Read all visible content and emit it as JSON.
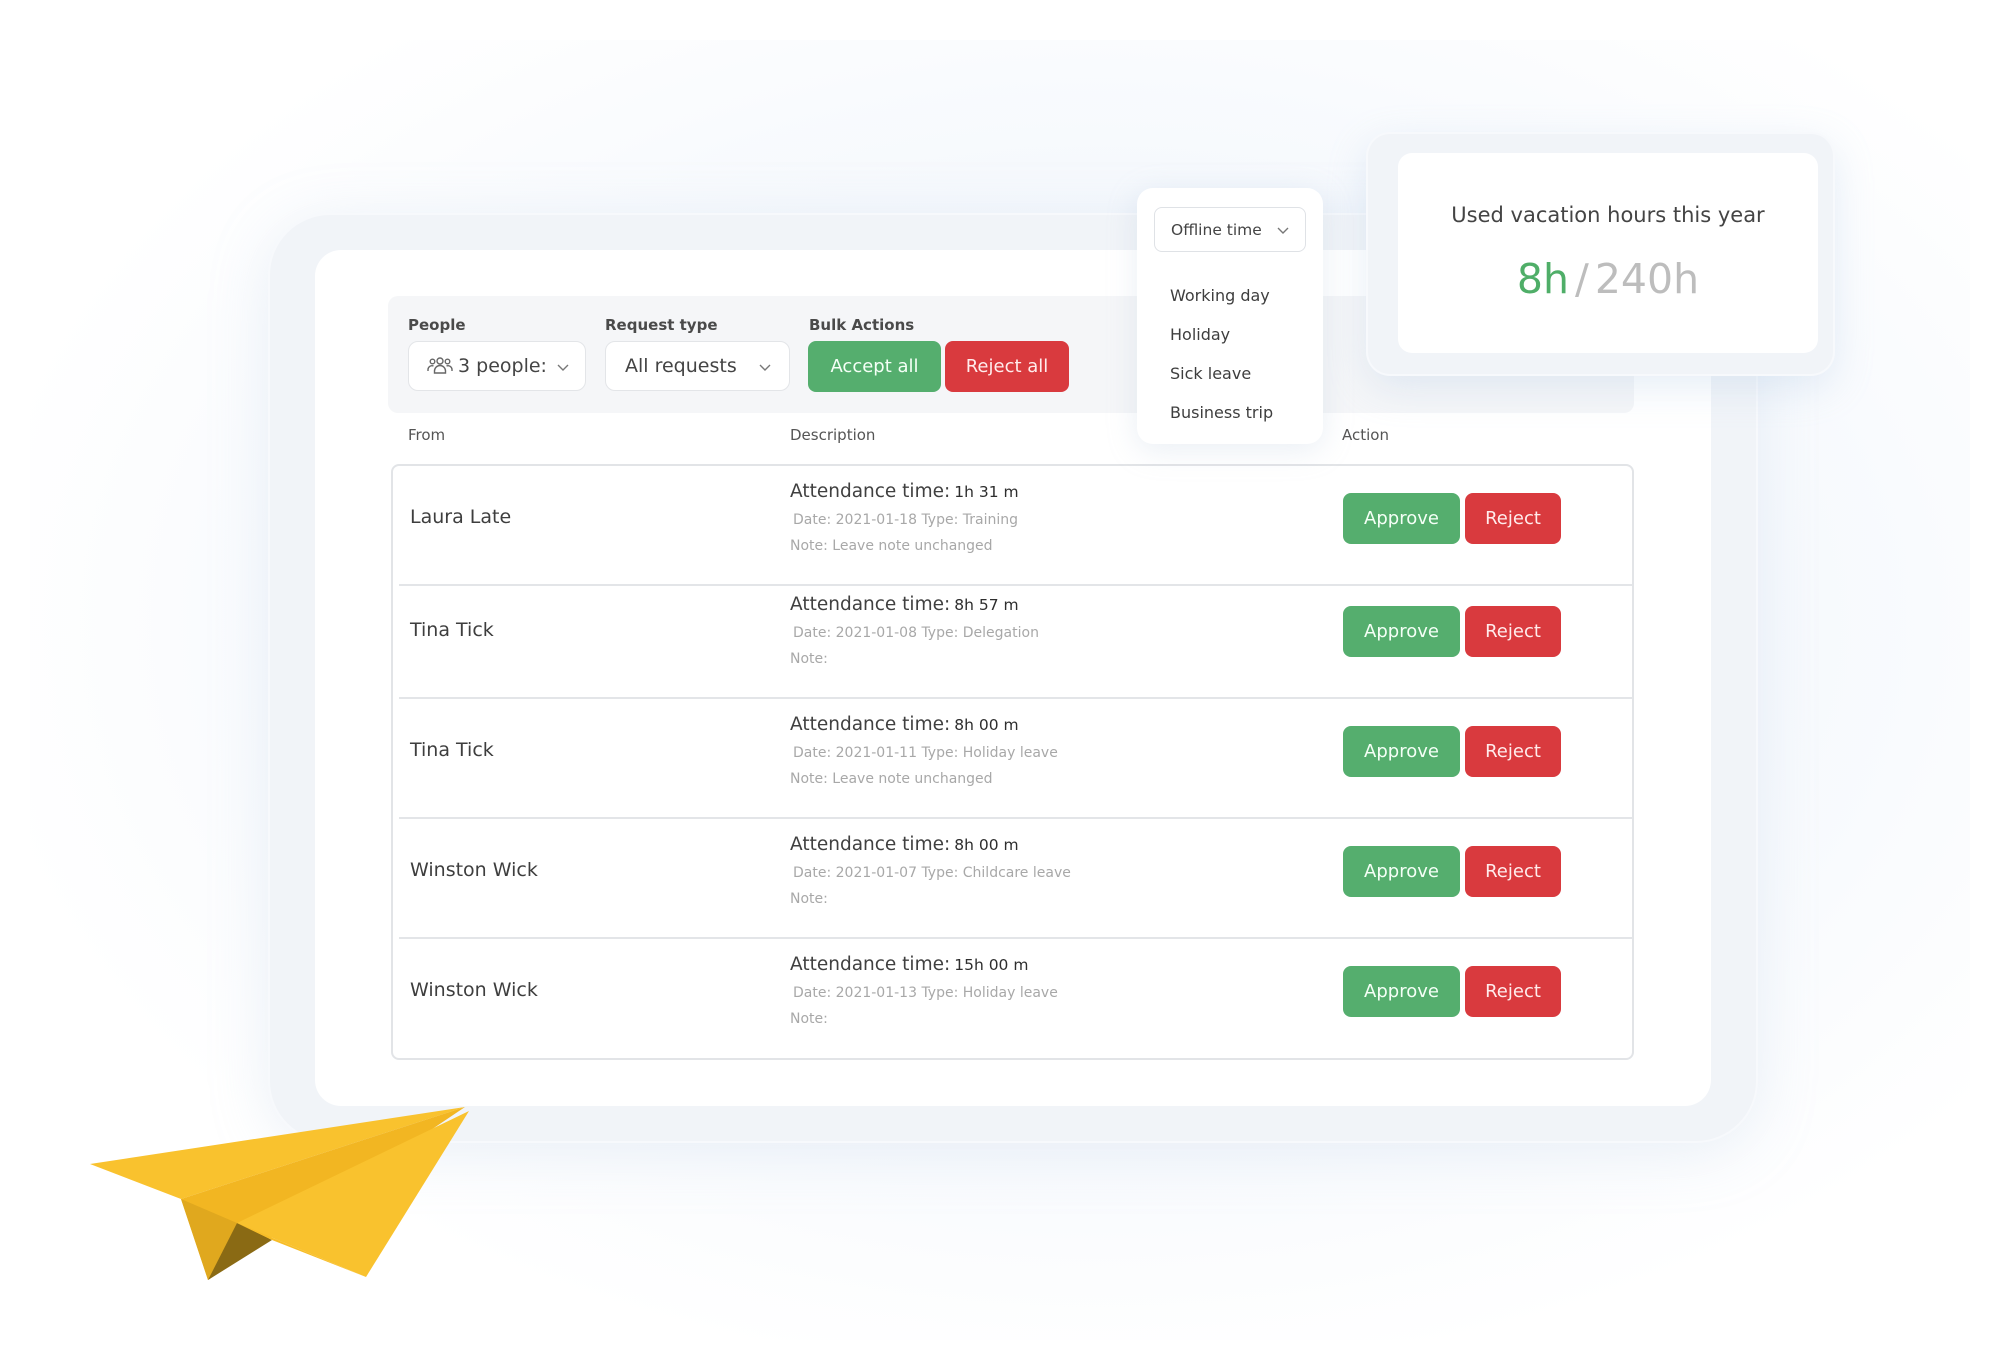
{
  "filters": {
    "people": {
      "label": "People",
      "icon": "people-icon",
      "value": "3 people:"
    },
    "request_type": {
      "label": "Request type",
      "value": "All requests"
    },
    "bulk_actions": {
      "label": "Bulk Actions",
      "accept_all": "Accept all",
      "reject_all": "Reject all"
    }
  },
  "table": {
    "columns": {
      "from": "From",
      "description": "Description",
      "action": "Action"
    },
    "attendance_label": "Attendance time:",
    "approve_label": "Approve",
    "reject_label": "Reject",
    "rows": [
      {
        "name": "Laura Late",
        "attendance": "1h 31 m",
        "meta": "Date: 2021-01-18 Type: Training",
        "note": "Note: Leave note unchanged"
      },
      {
        "name": "Tina Tick",
        "attendance": "8h 57 m",
        "meta": "Date: 2021-01-08 Type: Delegation",
        "note": "Note:"
      },
      {
        "name": "Tina Tick",
        "attendance": "8h 00 m",
        "meta": "Date: 2021-01-11 Type: Holiday leave",
        "note": "Note: Leave note unchanged"
      },
      {
        "name": "Winston Wick",
        "attendance": "8h 00 m",
        "meta": "Date: 2021-01-07 Type: Childcare leave",
        "note": "Note:"
      },
      {
        "name": "Winston Wick",
        "attendance": "15h 00 m",
        "meta": "Date: 2021-01-13 Type: Holiday leave",
        "note": "Note:"
      }
    ]
  },
  "offline_dropdown": {
    "selected": "Offline time",
    "options": [
      "Working day",
      "Holiday",
      "Sick leave",
      "Business trip"
    ]
  },
  "vacation_card": {
    "title": "Used vacation hours this year",
    "used": "8h",
    "separator": "/",
    "total": "240h"
  },
  "colors": {
    "approve": "#55ae6e",
    "reject": "#d93a3e",
    "vacation_used": "#4fae68",
    "vacation_total": "#bdbdbd",
    "plane": "#f9c22e"
  },
  "decoration": {
    "illustration": "paper-plane-icon"
  }
}
